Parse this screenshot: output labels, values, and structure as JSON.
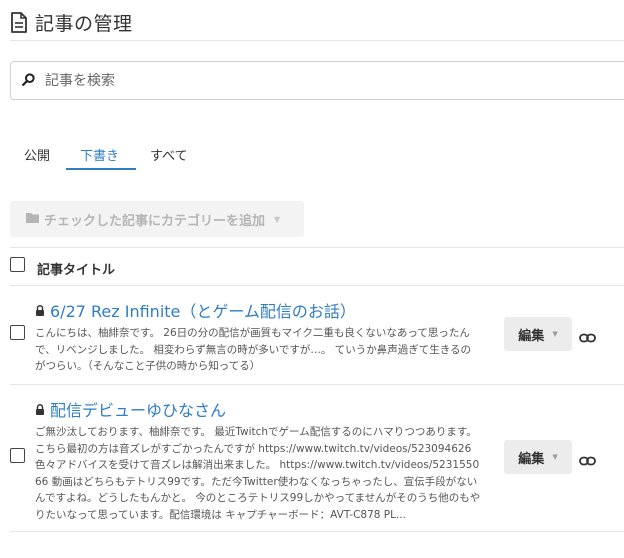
{
  "header": {
    "title": "記事の管理"
  },
  "search": {
    "placeholder": "記事を検索"
  },
  "tabs": [
    {
      "label": "公開",
      "active": false
    },
    {
      "label": "下書き",
      "active": true
    },
    {
      "label": "すべて",
      "active": false
    }
  ],
  "bulk_action": {
    "label": "チェックした記事にカテゴリーを追加"
  },
  "table": {
    "column_title": "記事タイトル"
  },
  "entries": [
    {
      "title": "6/27 Rez Infinite（とゲーム配信のお話）",
      "excerpt": "こんにちは、柚緋奈です。 26日の分の配信が画質もマイク二重も良くないなあって思ったんで、リベンジしました。 相変わらず無言の時が多いですが…。 ていうか鼻声過ぎて生きるのがつらい。（そんなこと子供の時から知ってる）",
      "edit_label": "編集"
    },
    {
      "title": "配信デビューゆひなさん",
      "excerpt": "ご無沙汰しております、柚緋奈です。 最近Twitchでゲーム配信するのにハマりつつあります。 こちら最初の方は音ズレがすごかったんですが https://www.twitch.tv/videos/523094626 色々アドバイスを受けて音ズレは解消出来ました。 https://www.twitch.tv/videos/523155066 動画はどちらもテトリス99です。ただ今Twitter使わなくなっちゃったし、宣伝手段がないんですよね。どうしたもんかと。 今のところテトリス99しかやってませんがそのうち他のもやりたいなって思っています。配信環境は キャプチャーボード：AVT-C878 PL...",
      "edit_label": "編集"
    }
  ],
  "icons": {
    "header": "document-icon",
    "search": "search-icon",
    "bulk": "folder-icon",
    "lock": "lock-icon",
    "link": "link-icon"
  },
  "colors": {
    "accent": "#2e7dc6"
  }
}
